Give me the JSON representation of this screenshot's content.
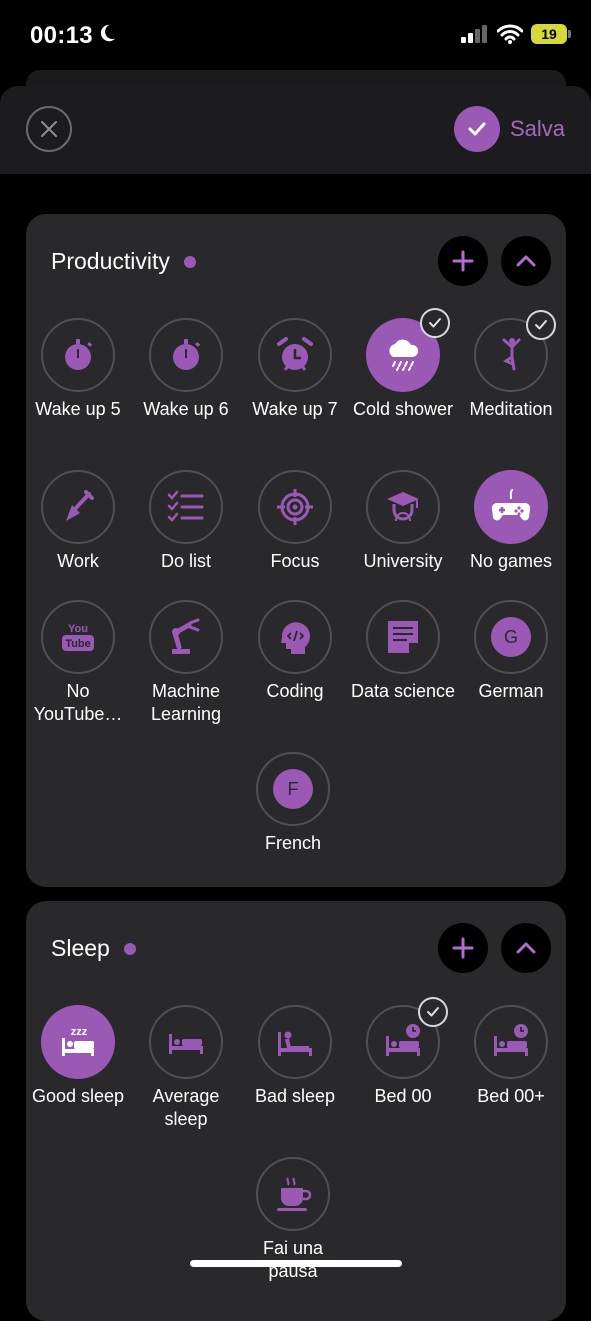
{
  "status": {
    "time": "00:13",
    "battery": "19"
  },
  "header": {
    "save_label": "Salva"
  },
  "sections": [
    {
      "title": "Productivity",
      "habits": [
        {
          "label": "Wake up 5",
          "icon": "stopwatch-icon",
          "selected": false,
          "checked": false
        },
        {
          "label": "Wake up 6",
          "icon": "stopwatch-icon",
          "selected": false,
          "checked": false
        },
        {
          "label": "Wake up 7",
          "icon": "alarm-clock-icon",
          "selected": false,
          "checked": false
        },
        {
          "label": "Cold shower",
          "icon": "rain-cloud-icon",
          "selected": true,
          "checked": true
        },
        {
          "label": "Meditation",
          "icon": "meditation-icon",
          "selected": false,
          "checked": true
        },
        {
          "label": "Work",
          "icon": "shovel-icon",
          "selected": false,
          "checked": false
        },
        {
          "label": "Do list",
          "icon": "checklist-icon",
          "selected": false,
          "checked": false
        },
        {
          "label": "Focus",
          "icon": "target-icon",
          "selected": false,
          "checked": false
        },
        {
          "label": "University",
          "icon": "graduate-icon",
          "selected": false,
          "checked": false
        },
        {
          "label": "No games",
          "icon": "gamepad-icon",
          "selected": true,
          "checked": false
        },
        {
          "label": "No YouTube…",
          "icon": "youtube-icon",
          "selected": false,
          "checked": false
        },
        {
          "label": "Machine Learning",
          "icon": "robot-arm-icon",
          "selected": false,
          "checked": false
        },
        {
          "label": "Coding",
          "icon": "coding-head-icon",
          "selected": false,
          "checked": false
        },
        {
          "label": "Data science",
          "icon": "document-icon",
          "selected": false,
          "checked": false
        },
        {
          "label": "German",
          "icon": "letter-g-icon",
          "letter": "G",
          "selected": false,
          "checked": false
        },
        {
          "label": "French",
          "icon": "letter-f-icon",
          "letter": "F",
          "selected": false,
          "checked": false
        }
      ]
    },
    {
      "title": "Sleep",
      "habits": [
        {
          "label": "Good sleep",
          "icon": "bed-zzz-icon",
          "badge": "zzz",
          "selected": true,
          "checked": false
        },
        {
          "label": "Average sleep",
          "icon": "bed-icon",
          "selected": false,
          "checked": false
        },
        {
          "label": "Bad sleep",
          "icon": "bed-sitting-icon",
          "selected": false,
          "checked": false
        },
        {
          "label": "Bed 00",
          "icon": "bed-clock-icon",
          "selected": false,
          "checked": true
        },
        {
          "label": "Bed 00+",
          "icon": "bed-clock-icon",
          "selected": false,
          "checked": false
        },
        {
          "label": "Fai una pausa",
          "icon": "coffee-cup-icon",
          "selected": false,
          "checked": false
        }
      ]
    }
  ],
  "colors": {
    "accent": "#9b59b6",
    "card": "#29292b",
    "background": "#000000"
  }
}
